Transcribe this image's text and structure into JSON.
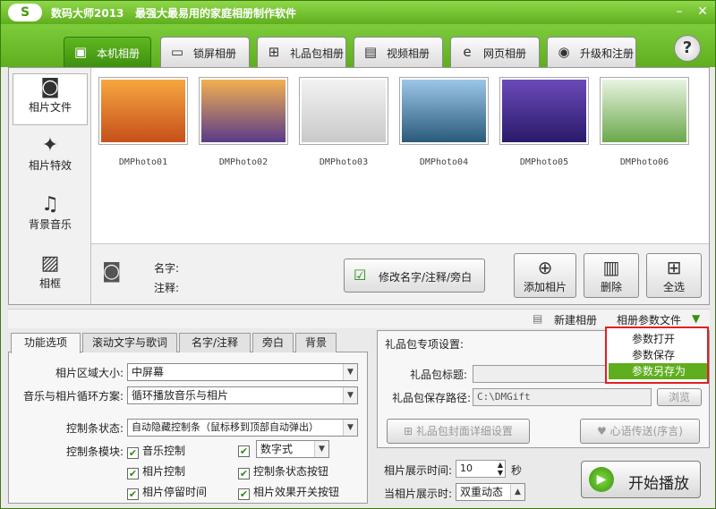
{
  "window": {
    "logo": "S",
    "app_name": "数码大师2013",
    "slogan": "最强大最易用的家庭相册制作软件",
    "minimize": "–",
    "close": "✕"
  },
  "top_tabs": [
    {
      "label": "本机相册",
      "icon": "photo-frame-icon"
    },
    {
      "label": "锁屏相册",
      "icon": "monitor-icon"
    },
    {
      "label": "礼品包相册",
      "icon": "gift-icon"
    },
    {
      "label": "视频相册",
      "icon": "film-icon"
    },
    {
      "label": "网页相册",
      "icon": "ie-icon"
    },
    {
      "label": "升级和注册",
      "icon": "globe-icon"
    }
  ],
  "help": "?",
  "sidebar": [
    {
      "label": "相片文件",
      "icon": "camera-icon"
    },
    {
      "label": "相片特效",
      "icon": "effects-icon"
    },
    {
      "label": "背景音乐",
      "icon": "music-note-icon"
    },
    {
      "label": "相框",
      "icon": "frame-icon"
    }
  ],
  "photos": [
    {
      "name": "DMPhoto01",
      "colors": [
        "#f6a640",
        "#c6501a"
      ]
    },
    {
      "name": "DMPhoto02",
      "colors": [
        "#f2b050",
        "#5a3a8a"
      ]
    },
    {
      "name": "DMPhoto03",
      "colors": [
        "#f2f2f2",
        "#c9c9c9"
      ]
    },
    {
      "name": "DMPhoto04",
      "colors": [
        "#9cc6e8",
        "#2a5a7a"
      ]
    },
    {
      "name": "DMPhoto05",
      "colors": [
        "#6a4ab8",
        "#2a1a6a"
      ]
    },
    {
      "name": "DMPhoto06",
      "colors": [
        "#e8f4e0",
        "#6aa84a"
      ]
    }
  ],
  "info": {
    "name_label": "名字:",
    "note_label": "注释:",
    "edit_button": "修改名字/注释/旁白",
    "add_button": "添加相片",
    "delete_button": "删除",
    "select_all_button": "全选"
  },
  "toolbar": {
    "new_album": "新建相册",
    "params_menu": "相册参数文件"
  },
  "params_menu": {
    "items": [
      "参数打开",
      "参数保存",
      "参数另存为"
    ],
    "highlighted": 2
  },
  "sub_tabs": [
    "功能选项",
    "滚动文字与歌词",
    "名字/注释",
    "旁白",
    "背景"
  ],
  "options": {
    "area_label": "相片区域大小:",
    "area_value": "中屏幕",
    "loop_label": "音乐与相片循环方案:",
    "loop_value": "循环播放音乐与相片",
    "control_label": "控制条状态:",
    "control_value": "自动隐藏控制条（鼠标移到顶部自动弹出）",
    "module_label": "控制条模块:",
    "checkboxes": [
      "音乐控制",
      "数字式",
      "相片控制",
      "控制条状态按钮",
      "相片停留时间",
      "相片效果开关按钮"
    ],
    "digital_value": "数字式"
  },
  "gift": {
    "title": "礼品包专项设置:",
    "title_label": "礼品包标题:",
    "path_label": "礼品包保存路径:",
    "path_value": "C:\\DMGift",
    "browse": "浏览",
    "cover_button": "礼品包封面详细设置",
    "heart_button": "心语传送(序言)"
  },
  "timing": {
    "show_time_label": "相片展示时间:",
    "show_time_value": "10",
    "unit": "秒",
    "when_label": "当相片展示时:",
    "when_value": "双重动态"
  },
  "start_button": "开始播放"
}
